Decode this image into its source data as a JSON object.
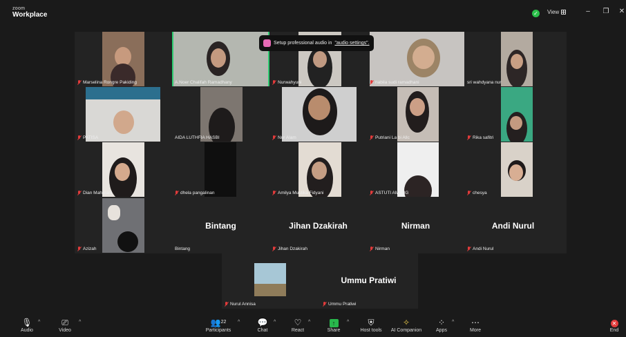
{
  "app": {
    "logo_line1": "zoom",
    "logo_line2": "Workplace"
  },
  "titlebar": {
    "view_label": "View",
    "minimize": "–",
    "restore": "❐",
    "close": "✕"
  },
  "toast": {
    "prefix": "Setup professional audio in",
    "link": "\"audio settings\"."
  },
  "participants": [
    {
      "name": "Marselina Rongre Pakiding"
    },
    {
      "name": "A.Noer Chalifah Ramadhany"
    },
    {
      "name": "Nurwahyuni"
    },
    {
      "name": "nabila sudi ramadhani"
    },
    {
      "name": "sri wahdyana nur"
    },
    {
      "name": "PATISA"
    },
    {
      "name": "AIDA LUTHFIA HASBI"
    },
    {
      "name": "Nur Alam"
    },
    {
      "name": "Putriani La bi Allc"
    },
    {
      "name": "Rika safitri"
    },
    {
      "name": "Dian Maharani"
    },
    {
      "name": "dhela pangalinan"
    },
    {
      "name": "Amilya Mustika Fidyani"
    },
    {
      "name": "ASTUTI AMANG"
    },
    {
      "name": "chesya"
    },
    {
      "name": "Azizah"
    },
    {
      "name": "Bintang",
      "big": "Bintang"
    },
    {
      "name": "Jihan Dzakirah",
      "big": "Jihan Dzakirah"
    },
    {
      "name": "Nirman",
      "big": "Nirman"
    },
    {
      "name": "Andi Nurul",
      "big": "Andi Nurul"
    },
    {
      "name": "Nurul Annisa"
    },
    {
      "name": "Ummu Pratiwi",
      "big": "Ummu Pratiwi"
    }
  ],
  "toolbar": {
    "audio": "Audio",
    "video": "Video",
    "participants": "Participants",
    "participants_count": "22",
    "chat": "Chat",
    "react": "React",
    "share": "Share",
    "host_tools": "Host tools",
    "ai_companion": "AI Companion",
    "apps": "Apps",
    "more": "More",
    "end": "End"
  },
  "colors": {
    "accent_green": "#2ecc71",
    "mute_red": "#e23b3b",
    "share_green": "#28b84c"
  }
}
